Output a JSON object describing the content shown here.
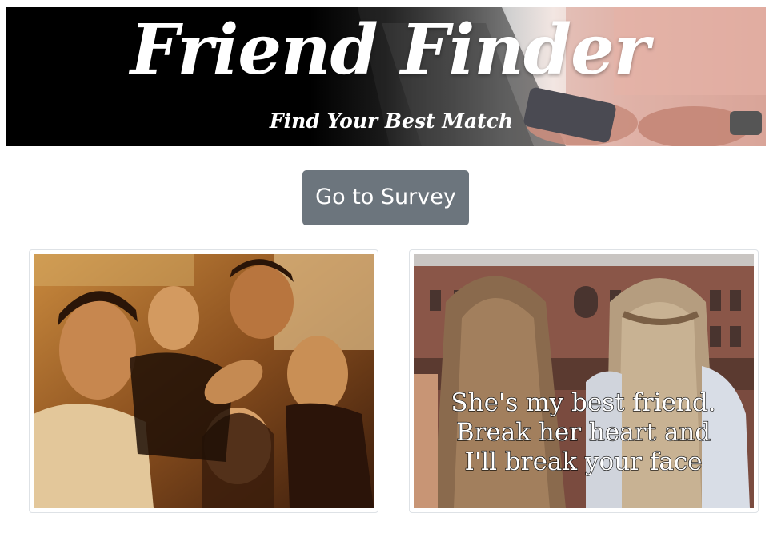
{
  "header": {
    "title": "Friend Finder",
    "subtitle": "Find Your Best Match"
  },
  "actions": {
    "survey_button_label": "Go to Survey"
  },
  "gallery": {
    "right_image_caption_lines": [
      "She's my best friend.",
      "Break her heart and",
      "I'll break your face"
    ]
  },
  "colors": {
    "button_bg": "#6c757d",
    "button_text": "#ffffff",
    "banner_bg": "#000000",
    "card_border": "#dee2e6"
  }
}
